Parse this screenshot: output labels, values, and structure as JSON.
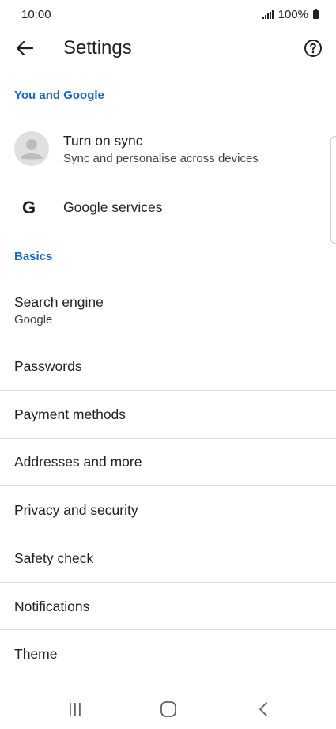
{
  "status_bar": {
    "time": "10:00",
    "battery_text": "100%",
    "signal_icon": "signal-icon",
    "battery_icon": "battery-icon"
  },
  "header": {
    "title": "Settings",
    "back_icon": "arrow-back-icon",
    "help_icon": "help-circle-icon"
  },
  "sections": {
    "you_and_google": "You and Google",
    "basics": "Basics"
  },
  "sync": {
    "title": "Turn on sync",
    "subtitle": "Sync and personalise across devices",
    "icon": "account-avatar-icon"
  },
  "google_services": {
    "title": "Google services",
    "icon_letter": "G",
    "icon": "google-logo-icon"
  },
  "search_engine": {
    "title": "Search engine",
    "value": "Google"
  },
  "items": [
    "Passwords",
    "Payment methods",
    "Addresses and more",
    "Privacy and security",
    "Safety check",
    "Notifications",
    "Theme"
  ],
  "nav_bar": {
    "recents_icon": "recents-icon",
    "home_icon": "home-icon",
    "back_icon": "nav-back-icon"
  },
  "colors": {
    "accent": "#1a66c9",
    "divider": "#dadce0",
    "text": "#202124"
  }
}
